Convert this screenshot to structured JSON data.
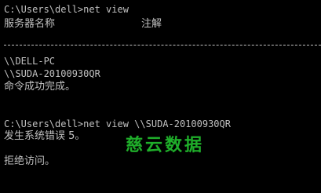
{
  "console": {
    "lines": [
      "C:\\Users\\dell>net view",
      "\\\\DELL-PC",
      "\\\\SUDA-20100930QR",
      "命令成功完成。",
      "C:\\Users\\dell>net view \\\\SUDA-20100930QR",
      "发生系统错误 5。",
      "拒绝访问。"
    ],
    "table_header": {
      "col_server_name": "服务器名称",
      "col_remark": "注解"
    }
  },
  "watermark": {
    "text": "慈云数据",
    "color": "#1fae2a"
  },
  "colors": {
    "background": "#000000",
    "foreground": "#c0c0c0"
  }
}
